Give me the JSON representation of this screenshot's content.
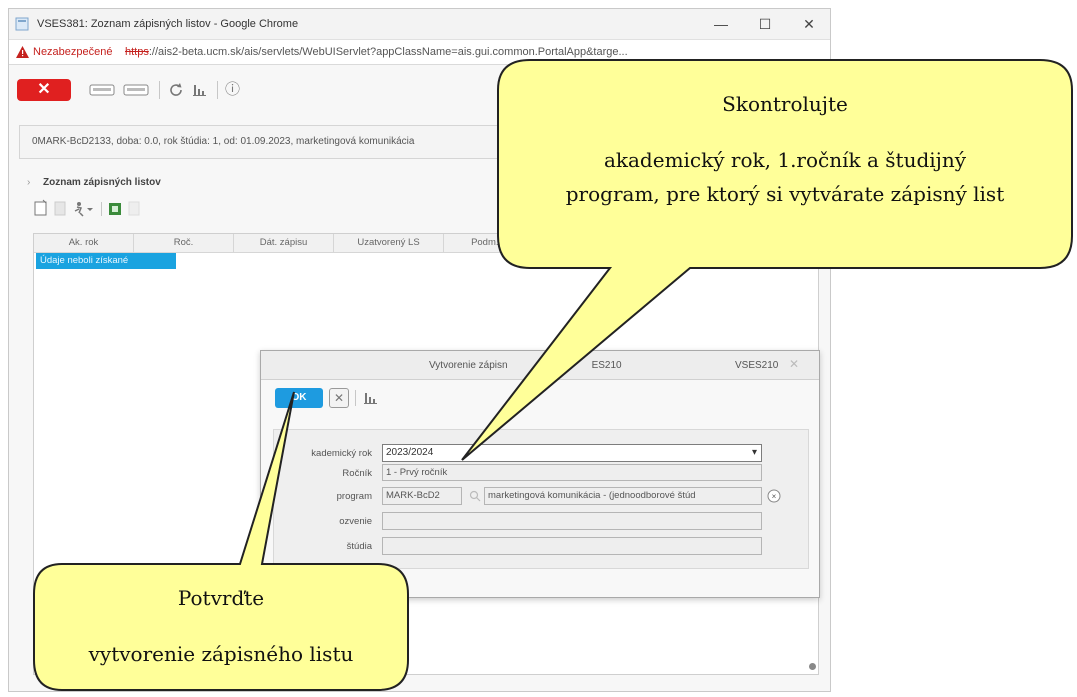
{
  "browser": {
    "tab_title": "VSES381: Zoznam zápisných listov - Google Chrome",
    "security_label": "Nezabezpečené",
    "url_scheme": "https",
    "url_rest": "://ais2-beta.ucm.sk/ais/servlets/WebUIServlet?appClassName=ais.gui.common.PortalApp&targe...",
    "minimize": "—",
    "maximize": "☐",
    "close": "✕"
  },
  "toolbar": {
    "close_label": "✕",
    "info_label": "ⓘ"
  },
  "info_bar": {
    "text": "0MARK-BcD2133, doba: 0.0, rok štúdia: 1, od: 01.09.2023, marketingová komunikácia"
  },
  "list_section": {
    "title": "Zoznam zápisných listov",
    "columns": [
      "Ak. rok",
      "Roč.",
      "Dát. zápisu",
      "Uzatvorený LS",
      "Podm. z"
    ],
    "empty_text": "Údaje neboli získané"
  },
  "dialog": {
    "title": "Vytvorenie zápisn",
    "title_tail": "ES210",
    "code": "VSES210",
    "ok_label": "OK",
    "cancel_label": "✕",
    "fields": {
      "academic_year_label": "kademický rok",
      "academic_year_value": "2023/2024",
      "year_label": "Ročník",
      "year_value": "1 - Prvý ročník",
      "program_label": "program",
      "program_code": "MARK-BcD2",
      "program_name": "marketingová komunikácia - (jednoodborové štúd",
      "row4_label": "ozvenie",
      "row5_label": "štúdia"
    }
  },
  "callouts": {
    "top_line1": "Skontrolujte",
    "top_line2": "akademický rok, 1.ročník a študijný",
    "top_line3": "program, pre ktorý si vytvárate zápisný list",
    "bottom_line1": "Potvrďte",
    "bottom_line2": "vytvorenie zápisného listu"
  },
  "colors": {
    "callout_fill": "#ffff99",
    "ok_blue": "#1e9be0",
    "close_red": "#e02020",
    "nodata_blue": "#1aa3e0"
  }
}
